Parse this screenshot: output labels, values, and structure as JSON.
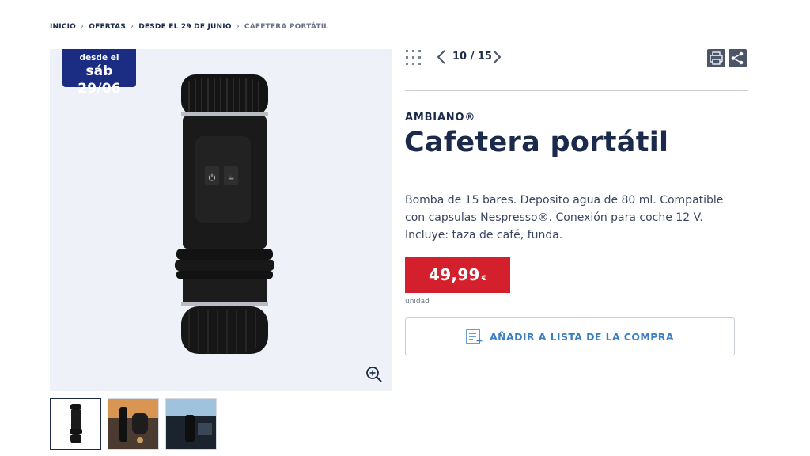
{
  "breadcrumb": {
    "items": [
      "INICIO",
      "OFERTAS",
      "DESDE EL 29 DE JUNIO",
      "CAFETERA PORTÁTIL"
    ]
  },
  "badge": {
    "line1": "desde el",
    "line2": "sáb 29/06"
  },
  "pager": {
    "counter": "10 / 15"
  },
  "product": {
    "brand": "AMBIANO®",
    "title": "Cafetera portátil",
    "description": "Bomba de 15 bares. Deposito agua de 80 ml. Compatible con capsulas Nespresso®. Conexión para coche 12 V. Incluye: taza de café, funda.",
    "price": "49,99",
    "currency": "€",
    "unit": "unidad"
  },
  "actions": {
    "add_to_list": "AÑADIR A LISTA DE LA COMPRA"
  },
  "colors": {
    "navy": "#1b2a4a",
    "badge": "#1a2d82",
    "price_red": "#d4202c",
    "link_blue": "#3a7fc1"
  },
  "icons": [
    "grid-icon",
    "chevron-left-icon",
    "chevron-right-icon",
    "print-icon",
    "share-icon",
    "zoom-in-icon",
    "shopping-list-icon"
  ]
}
